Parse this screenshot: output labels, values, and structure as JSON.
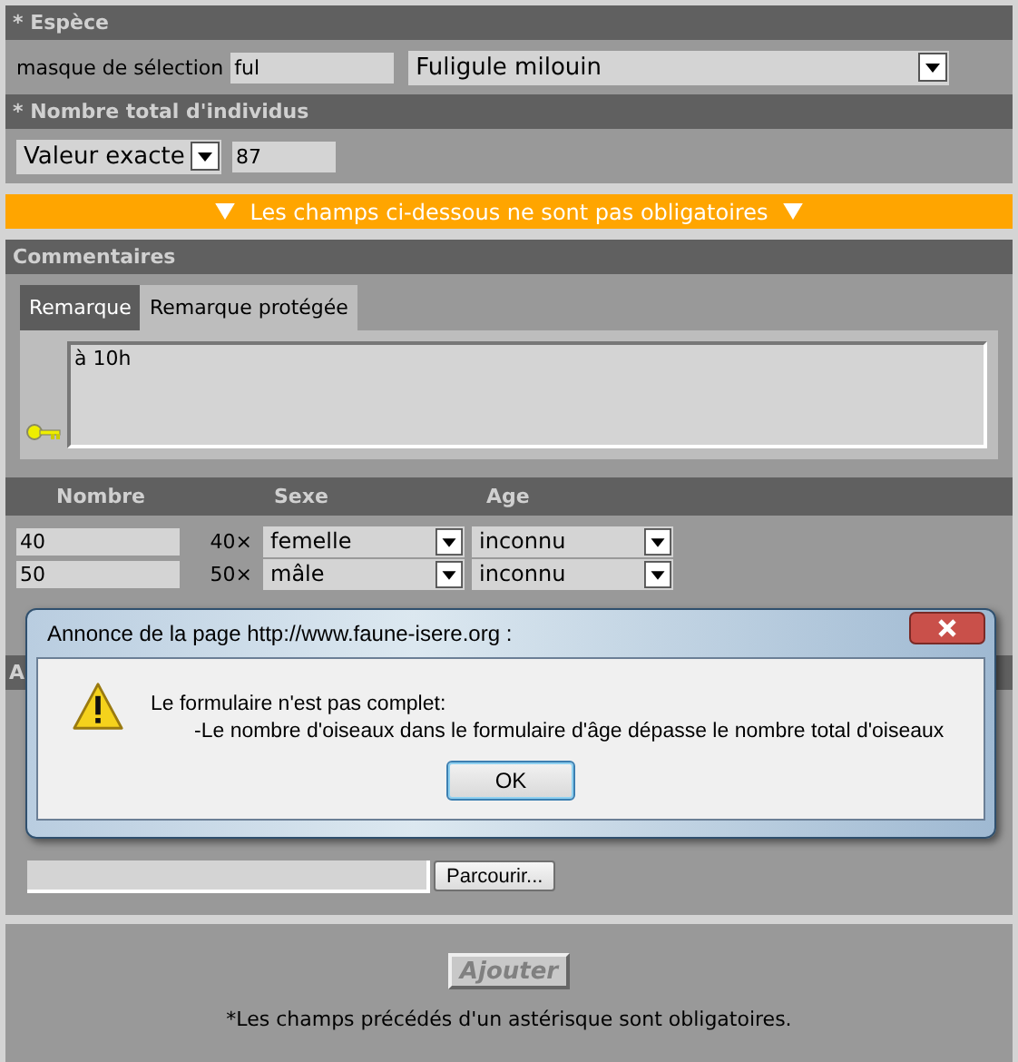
{
  "espece": {
    "title": "* Espèce",
    "mask_label": "masque de sélection",
    "mask_value": "ful",
    "species": "Fuligule milouin"
  },
  "total": {
    "title": "* Nombre total d'individus",
    "mode": "Valeur exacte",
    "value": "87"
  },
  "optional_banner": "Les champs ci-dessous ne sont pas obligatoires",
  "commentaires": {
    "title": "Commentaires",
    "tabs": [
      {
        "label": "Remarque",
        "selected": true
      },
      {
        "label": "Remarque protégée",
        "selected": false
      }
    ],
    "text": "à 10h"
  },
  "details": {
    "columns": [
      "Nombre",
      "Sexe",
      "Age"
    ],
    "rows": [
      {
        "nombre": "40",
        "multiplier": "40×",
        "sexe": "femelle",
        "age": "inconnu"
      },
      {
        "nombre": "50",
        "multiplier": "50×",
        "sexe": "mâle",
        "age": "inconnu"
      }
    ]
  },
  "hidden_section": {
    "title": "A"
  },
  "attachment": {
    "browse_button": "Parcourir..."
  },
  "submit": {
    "label": "Ajouter",
    "disabled": true
  },
  "footnote": "*Les champs précédés d'un astérisque sont obligatoires.",
  "dialog": {
    "title": "Annonce de la page http://www.faune-isere.org :",
    "message": [
      "Le formulaire n'est pas complet:",
      "-Le nombre d'oiseaux dans le formulaire d'âge dépasse le nombre total d'oiseaux"
    ],
    "button": "OK"
  }
}
